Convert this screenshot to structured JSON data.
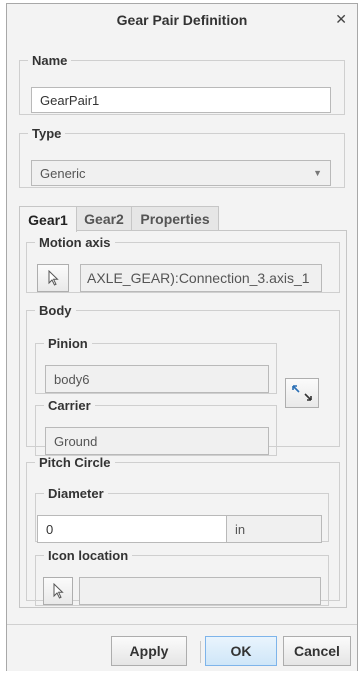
{
  "dialog": {
    "title": "Gear Pair Definition"
  },
  "name_group": {
    "legend": "Name",
    "value": "GearPair1"
  },
  "type_group": {
    "legend": "Type",
    "selected": "Generic"
  },
  "tabs": [
    {
      "label": "Gear1",
      "active": true
    },
    {
      "label": "Gear2",
      "active": false
    },
    {
      "label": "Properties",
      "active": false
    }
  ],
  "motion_axis": {
    "legend": "Motion axis",
    "value": "AXLE_GEAR):Connection_3.axis_1"
  },
  "body": {
    "legend": "Body",
    "pinion": {
      "legend": "Pinion",
      "value": "body6"
    },
    "carrier": {
      "legend": "Carrier",
      "value": "Ground"
    }
  },
  "pitch_circle": {
    "legend": "Pitch Circle",
    "diameter": {
      "legend": "Diameter",
      "value": "0",
      "unit": "in"
    },
    "icon_location": {
      "legend": "Icon location",
      "value": ""
    }
  },
  "footer": {
    "apply": "Apply",
    "ok": "OK",
    "cancel": "Cancel"
  },
  "icons": {
    "close": "close-icon",
    "dropdown": "chevron-down-icon",
    "select": "arrow-cursor-icon",
    "swap": "swap-diagonal-icon"
  }
}
